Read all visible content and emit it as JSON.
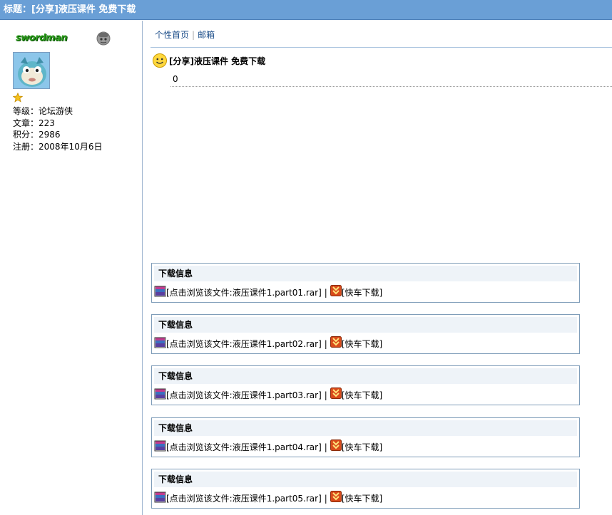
{
  "title_bar": {
    "text": "标题：[分享]液压课件 免费下载"
  },
  "author": {
    "username": "swordman",
    "level_label": "等级：",
    "level": "论坛游侠",
    "posts_label": "文章：",
    "posts": "223",
    "points_label": "积分：",
    "points": "2986",
    "registered_label": "注册：",
    "registered": "2008年10月6日",
    "status_icon": "user-offline-icon",
    "rank_icon": "star-icon"
  },
  "nav": {
    "home": "个性首页",
    "separator": "|",
    "mail": "邮箱"
  },
  "post": {
    "icon": "smile-icon",
    "title": "[分享]液压课件 免费下载",
    "body": "0"
  },
  "downloads": [
    {
      "header": "下载信息",
      "file_link": "[点击浏览该文件:液压课件1.part01.rar]",
      "separator": "|",
      "fast_link": "[快车下载]"
    },
    {
      "header": "下载信息",
      "file_link": "[点击浏览该文件:液压课件1.part02.rar]",
      "separator": "|",
      "fast_link": "[快车下载]"
    },
    {
      "header": "下载信息",
      "file_link": "[点击浏览该文件:液压课件1.part03.rar]",
      "separator": "|",
      "fast_link": "[快车下载]"
    },
    {
      "header": "下载信息",
      "file_link": "[点击浏览该文件:液压课件1.part04.rar]",
      "separator": "|",
      "fast_link": "[快车下载]"
    },
    {
      "header": "下载信息",
      "file_link": "[点击浏览该文件:液压课件1.part05.rar]",
      "separator": "|",
      "fast_link": "[快车下载]"
    }
  ],
  "colors": {
    "title_bar": "#6a9fd6",
    "box_border": "#7f9db9",
    "box_header": "#eef3f8",
    "nav_link": "#1e4f8a"
  }
}
